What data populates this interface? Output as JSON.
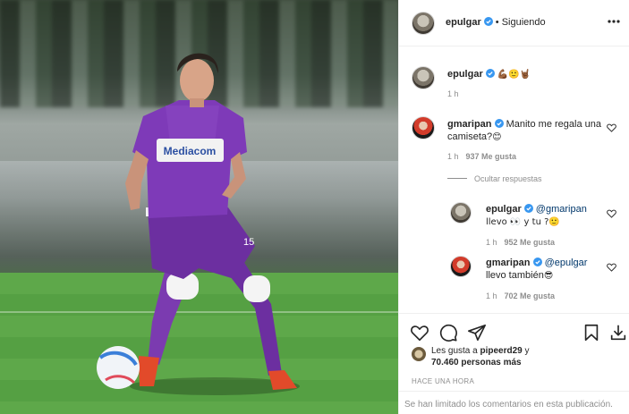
{
  "post": {
    "author": "epulgar",
    "follow_status": "• Siguiendo",
    "caption_emojis": "💪🏾🙂🤘🏾",
    "caption_time": "1 h"
  },
  "comments": [
    {
      "user": "gmaripan",
      "text": "Manito me regala una camiseta?",
      "emoji": "😊",
      "time": "1 h",
      "likes": "937 Me gusta",
      "toggle_replies": "Ocultar respuestas",
      "replies": [
        {
          "user": "epulgar",
          "mention": "@gmaripan",
          "text": "llevo 👀 y tu ?",
          "emoji": "🙂",
          "time": "1 h",
          "likes": "952 Me gusta"
        },
        {
          "user": "gmaripan",
          "mention": "@epulgar",
          "text": "llevo también",
          "emoji": "😎",
          "time": "1 h",
          "likes": "702 Me gusta"
        }
      ]
    }
  ],
  "likes_summary": {
    "prefix": "Les gusta a ",
    "user": "pipeerd29",
    "connector": " y",
    "others": "70.460 personas más"
  },
  "posted_ago": "HACE UNA HORA",
  "comments_limited": "Se han limitado los comentarios en esta publicación.",
  "photo": {
    "jersey_sponsor": "Mediacom",
    "jersey_number": "15"
  },
  "icons": {
    "verified": "verified-badge-icon",
    "more": "more-options-icon",
    "heart": "heart-icon",
    "comment": "comment-icon",
    "share": "share-icon",
    "save": "bookmark-icon"
  },
  "colors": {
    "verified_blue": "#3897f0",
    "jersey_purple": "#6c2fa0",
    "text": "#262626",
    "muted": "#8e8e8e"
  }
}
